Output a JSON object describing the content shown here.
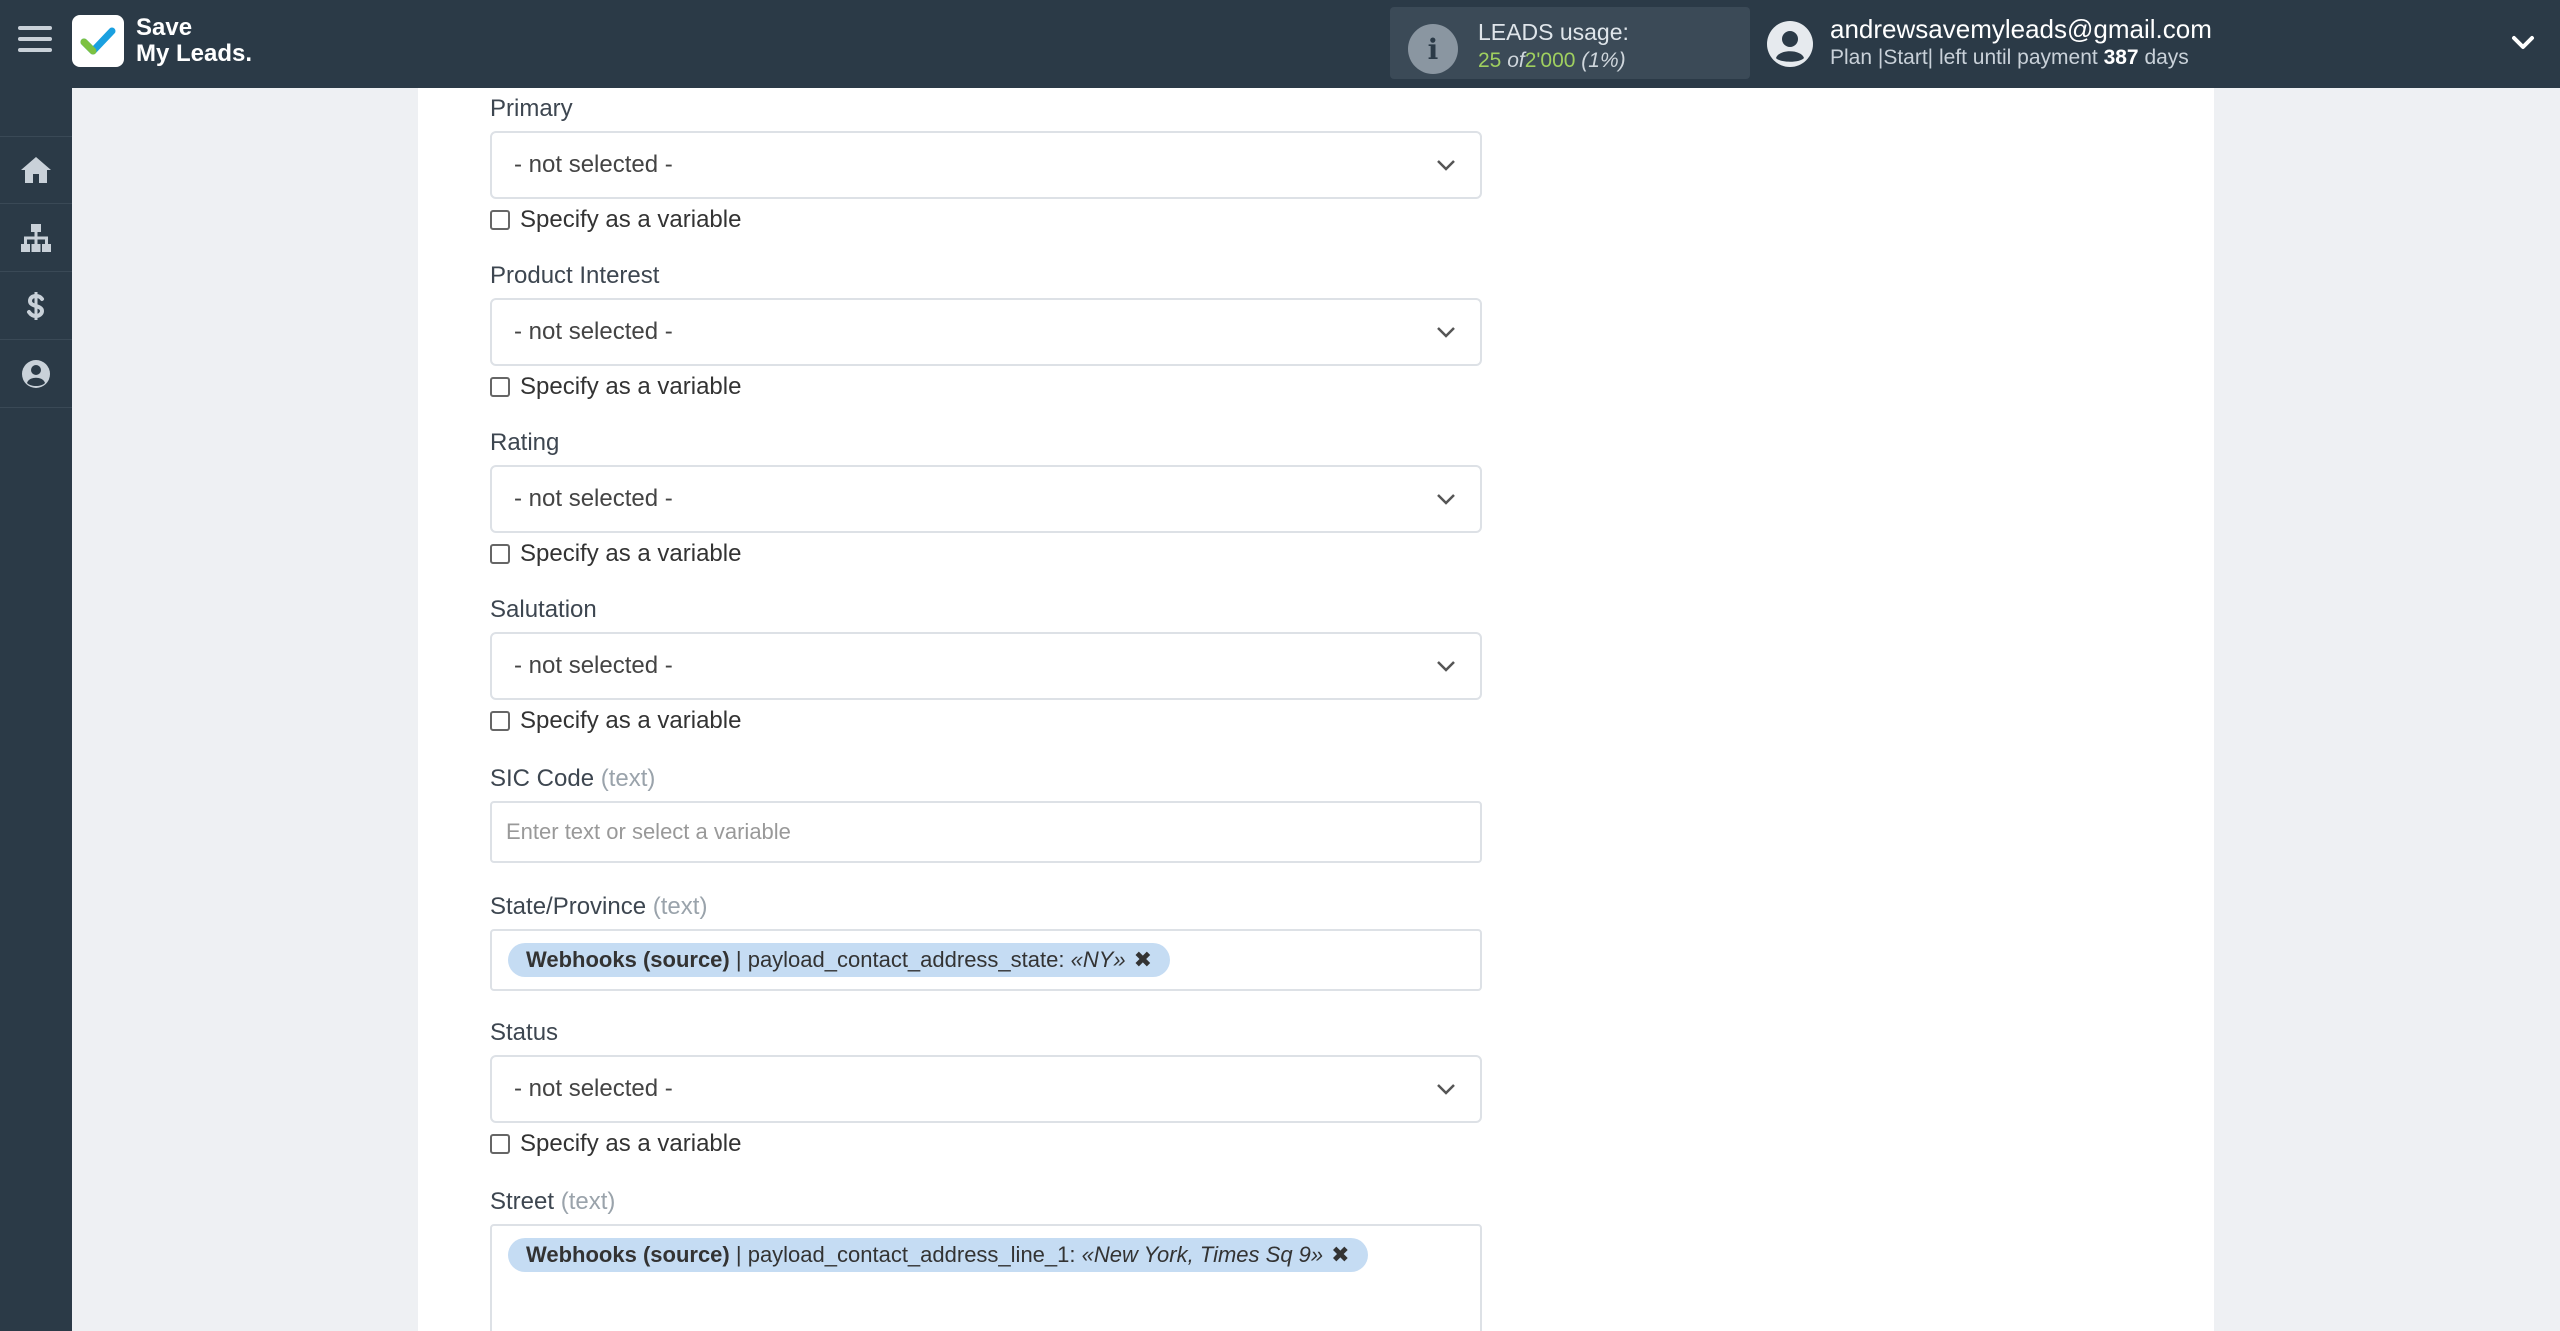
{
  "app": {
    "logo_line1": "Save",
    "logo_line2": "My Leads."
  },
  "leads": {
    "label": "LEADS usage:",
    "used": "25",
    "of": "of",
    "total": "2'000",
    "percent": "(1%)"
  },
  "user": {
    "email": "andrewsavemyleads@gmail.com",
    "plan_prefix": "Plan |Start| left until payment",
    "days": "387",
    "days_suffix": "days"
  },
  "sidebar": {
    "items": [
      {
        "name": "home-icon"
      },
      {
        "name": "sitemap-icon"
      },
      {
        "name": "dollar-icon"
      },
      {
        "name": "account-icon"
      }
    ]
  },
  "form": {
    "not_selected": "- not selected -",
    "specify_variable": "Specify as a variable",
    "text_hint": "(text)",
    "fields": {
      "primary": {
        "label": "Primary"
      },
      "product_interest": {
        "label": "Product Interest"
      },
      "rating": {
        "label": "Rating"
      },
      "salutation": {
        "label": "Salutation"
      },
      "sic_code": {
        "label": "SIC Code",
        "placeholder": "Enter text or select a variable"
      },
      "state": {
        "label": "State/Province",
        "tag_source": "Webhooks (source)",
        "tag_field": "| payload_contact_address_state:",
        "tag_value": "«NY»"
      },
      "status": {
        "label": "Status"
      },
      "street": {
        "label": "Street",
        "tag_source": "Webhooks (source)",
        "tag_field": "| payload_contact_address_line_1:",
        "tag_value": "«New York, Times Sq 9»"
      }
    }
  }
}
